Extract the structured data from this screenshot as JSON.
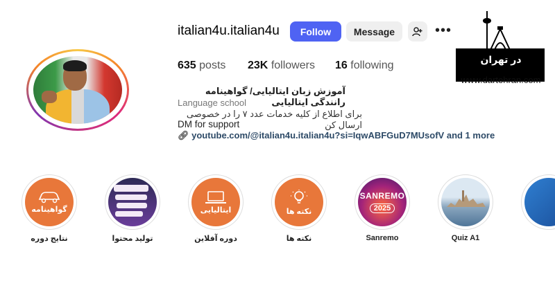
{
  "profile": {
    "username": "italian4u.italian4u",
    "follow_label": "Follow",
    "message_label": "Message"
  },
  "stats": {
    "posts_count": "635",
    "posts_label": "posts",
    "followers_count": "23K",
    "followers_label": "followers",
    "following_count": "16",
    "following_label": "following"
  },
  "bio": {
    "title": "آموزش زبان ایتالیایی/ گواهینامه رانندگی ایتالیایی",
    "category": "Language school",
    "line1": "برای اطلاع از کلیه خدمات عدد ۷ را در خصوصی ارسال کن",
    "line2": "DM for support",
    "link": "youtube.com/@italian4u.italian4u?si=IqwABFGuD7MUsofV and 1 more"
  },
  "watermark": {
    "brand": "در تهران",
    "url": "www.dartehran.com"
  },
  "highlights": [
    {
      "label": "نتایج دوره",
      "inner_text": "گواهینامه",
      "icon": "car-icon"
    },
    {
      "label": "تولید محتوا",
      "inner_text": "",
      "icon": "content-thumbnail"
    },
    {
      "label": "دوره آفلاین",
      "inner_text": "ایتالیایی",
      "icon": "laptop-icon"
    },
    {
      "label": "نکته ها",
      "inner_text": "نکته ها",
      "icon": "lightbulb-icon"
    },
    {
      "label": "Sanremo",
      "inner_text": "SANREMO",
      "inner_year": "2025",
      "icon": "sanremo-thumbnail"
    },
    {
      "label": "Quiz A1",
      "inner_text": "",
      "icon": "venice-thumbnail"
    },
    {
      "label": "",
      "inner_text": "",
      "icon": "blue-thumbnail"
    }
  ],
  "colors": {
    "follow_button": "#4f63f3",
    "highlight_orange": "#e8773a",
    "link": "#2d4a67"
  }
}
